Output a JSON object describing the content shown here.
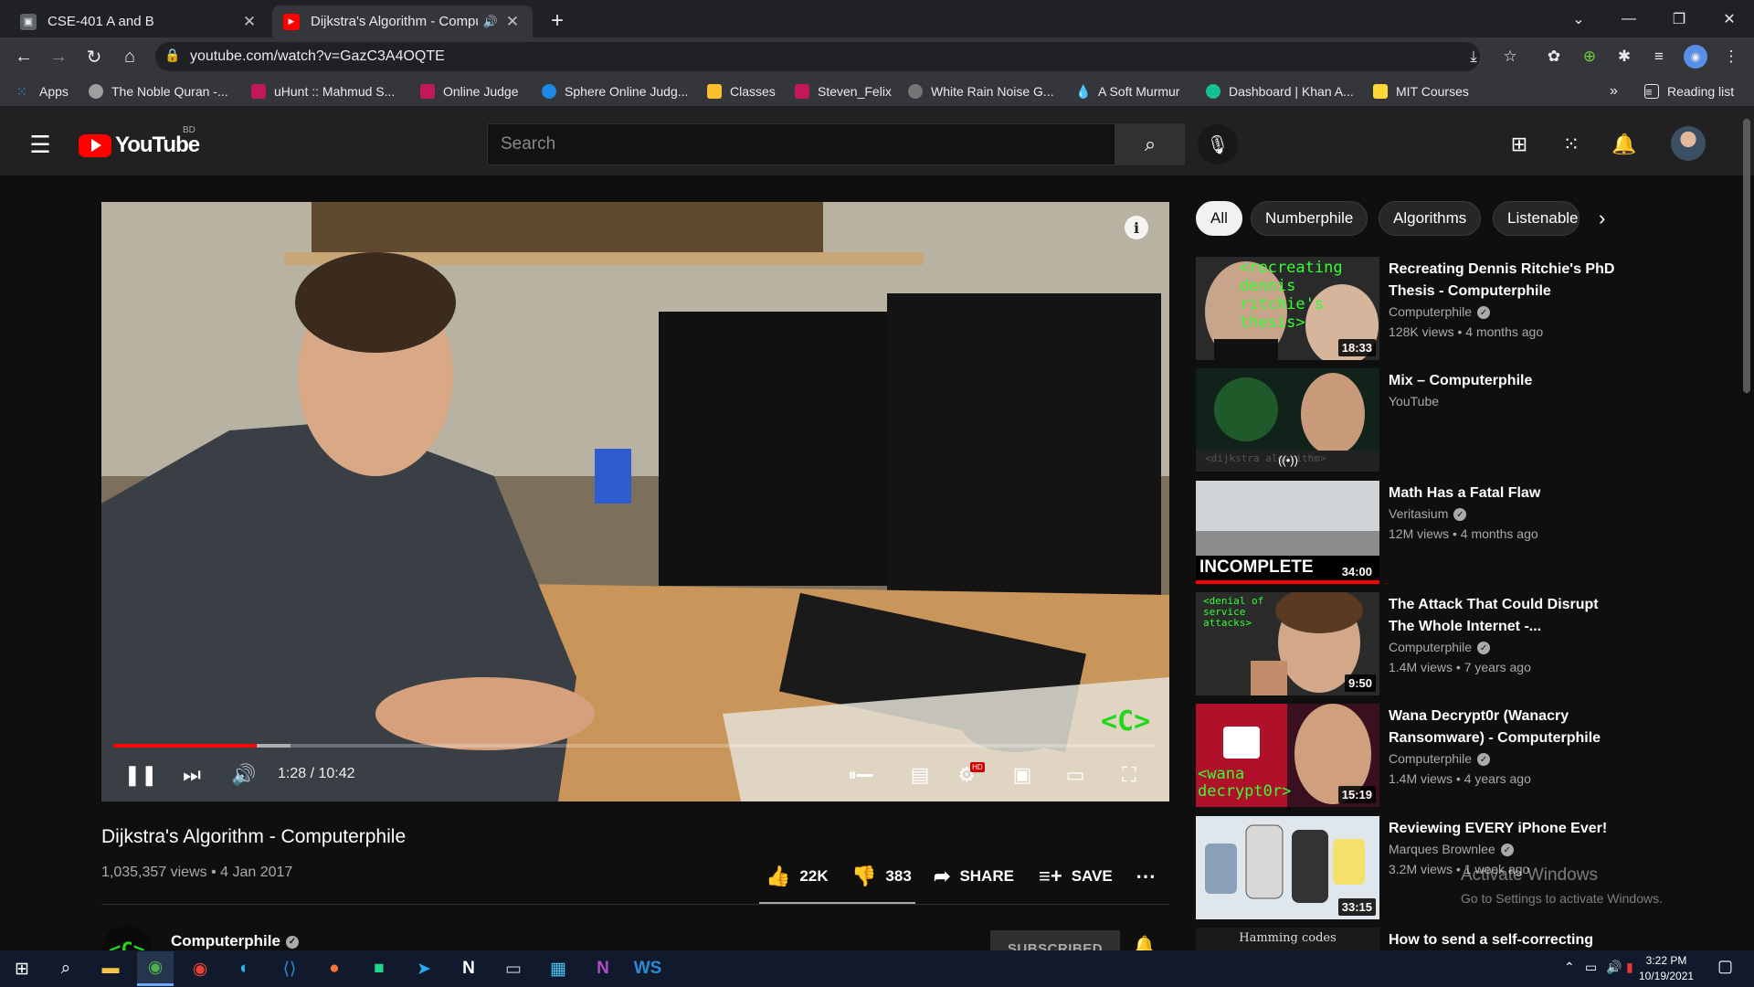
{
  "browser": {
    "tabs": [
      {
        "title": "CSE-401 A and B",
        "active": false
      },
      {
        "title": "Dijkstra's Algorithm - Computerphile",
        "active": true
      }
    ],
    "url": "youtube.com/watch?v=GazC3A4OQTE",
    "bookmarks": [
      {
        "label": "Apps",
        "color": "#4285f4"
      },
      {
        "label": "The Noble Quran -...",
        "color": "#9e9e9e"
      },
      {
        "label": "uHunt :: Mahmud S...",
        "color": "#c2185b"
      },
      {
        "label": "Online Judge",
        "color": "#c2185b"
      },
      {
        "label": "Sphere Online Judg...",
        "color": "#1e88e5"
      },
      {
        "label": "Classes",
        "color": "#fbc02d"
      },
      {
        "label": "Steven_Felix",
        "color": "#c2185b"
      },
      {
        "label": "White Rain Noise G...",
        "color": "#757575"
      },
      {
        "label": "A Soft Murmur",
        "color": "#29b6f6"
      },
      {
        "label": "Dashboard | Khan A...",
        "color": "#14bf96"
      },
      {
        "label": "MIT Courses",
        "color": "#fdd835"
      }
    ],
    "reading_list": "Reading list"
  },
  "youtube": {
    "logo_text": "YouTube",
    "country_code": "BD",
    "search_placeholder": "Search"
  },
  "player": {
    "current_time": "1:28",
    "duration": "10:42",
    "time_display": "1:28 / 10:42",
    "progress_fraction": 0.138,
    "buffered_fraction": 0.17,
    "channel_watermark": "<C>",
    "hd_badge": "HD"
  },
  "video": {
    "title": "Dijkstra's Algorithm - Computerphile",
    "meta": "1,035,357 views • 4 Jan 2017",
    "likes": "22K",
    "dislikes": "383",
    "share_label": "SHARE",
    "save_label": "SAVE",
    "channel": "Computerphile",
    "subscribe_label": "SUBSCRIBED"
  },
  "chips": [
    "All",
    "Numberphile",
    "Algorithms",
    "Listenable"
  ],
  "recommendations": [
    {
      "title": "Recreating Dennis Ritchie's PhD Thesis - Computerphile",
      "channel": "Computerphile",
      "verified": true,
      "views": "128K views • 4 months ago",
      "duration": "18:33",
      "thumb_text": "<recreating dennis ritchie's thesis>"
    },
    {
      "title": "Mix – Computerphile",
      "channel": "YouTube",
      "verified": false,
      "views": "",
      "duration": "",
      "thumb_text": "<dijkstra algorithm>"
    },
    {
      "title": "Math Has a Fatal Flaw",
      "channel": "Veritasium",
      "verified": true,
      "views": "12M views • 4 months ago",
      "duration": "34:00",
      "thumb_text": "INCOMPLETE"
    },
    {
      "title": "The Attack That Could Disrupt The Whole Internet -...",
      "channel": "Computerphile",
      "verified": true,
      "views": "1.4M views • 7 years ago",
      "duration": "9:50",
      "thumb_text": "<denial of service attacks>"
    },
    {
      "title": "Wana Decrypt0r (Wanacry Ransomware) - Computerphile",
      "channel": "Computerphile",
      "verified": true,
      "views": "1.4M views • 4 years ago",
      "duration": "15:19",
      "thumb_text": "<wana decrypt0r>"
    },
    {
      "title": "Reviewing EVERY iPhone Ever!",
      "channel": "Marques Brownlee",
      "verified": true,
      "views": "3.2M views • 1 week ago",
      "duration": "33:15",
      "thumb_text": ""
    },
    {
      "title": "How to send a self-correcting",
      "channel": "",
      "verified": false,
      "views": "",
      "duration": "",
      "thumb_text": "Hamming codes"
    }
  ],
  "watermark": {
    "line1": "Activate Windows",
    "line2": "Go to Settings to activate Windows."
  },
  "taskbar": {
    "time": "3:22 PM",
    "date": "10/19/2021"
  }
}
